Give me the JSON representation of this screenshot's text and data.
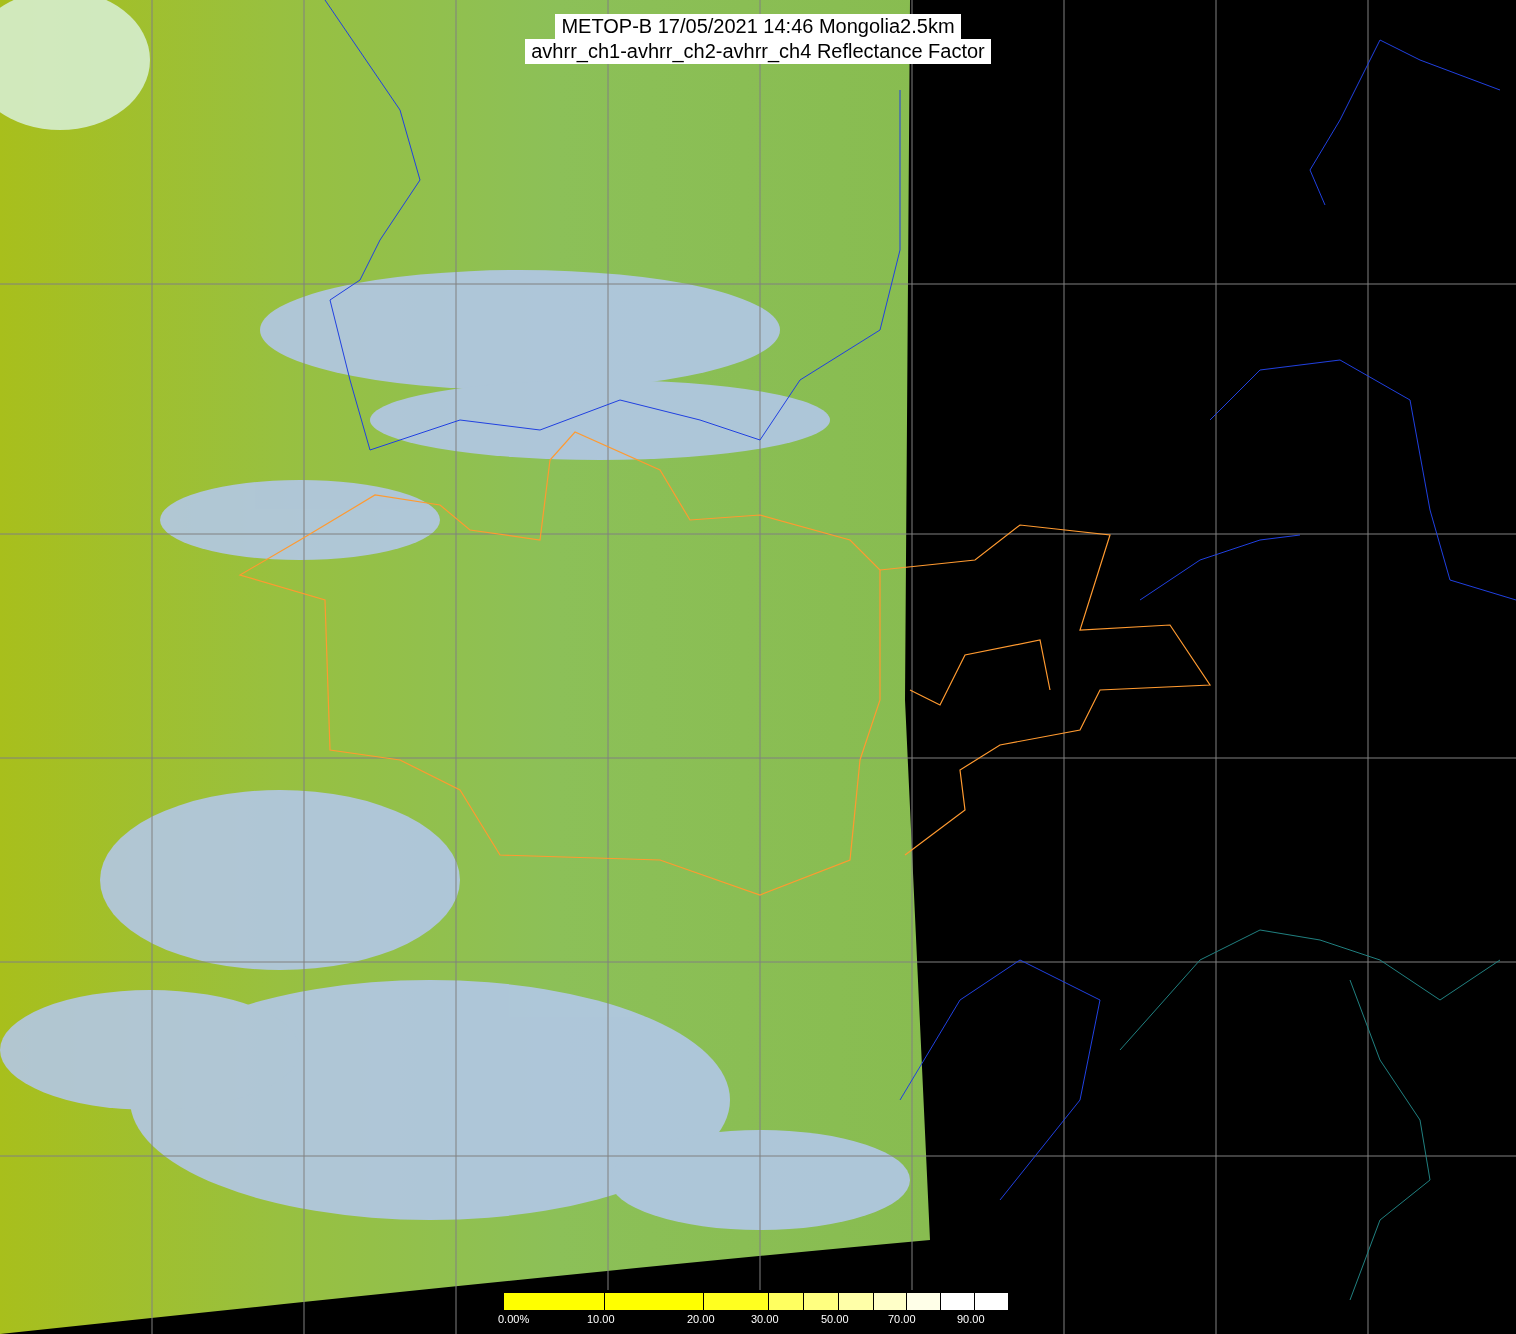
{
  "title_lines": [
    "METOP-B 17/05/2021 14:46 Mongolia2.5km",
    "avhrr_ch1-avhrr_ch2-avhrr_ch4 Reflectance Factor"
  ],
  "colorbar": {
    "segments": [
      {
        "color": "#ffff00"
      },
      {
        "color": "#ffff00"
      },
      {
        "color": "#ffff20"
      },
      {
        "color": "#ffff60"
      },
      {
        "color": "#ffff80"
      },
      {
        "color": "#ffffa8"
      },
      {
        "color": "#ffffc8"
      },
      {
        "color": "#ffffe8"
      },
      {
        "color": "#ffffff"
      },
      {
        "color": "#ffffff"
      }
    ],
    "labels": [
      "0.00%",
      "10.00",
      "20.00",
      "30.00",
      "50.00",
      "70.00",
      "90.00"
    ]
  }
}
